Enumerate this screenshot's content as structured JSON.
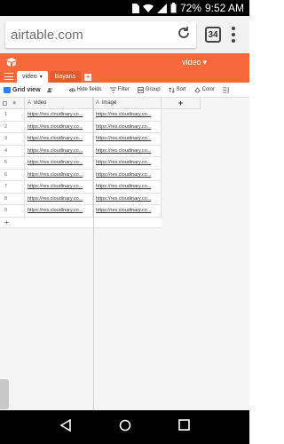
{
  "status_bar": {
    "battery": "72%",
    "time": "9:52 AM"
  },
  "browser": {
    "url": "airtable.com",
    "tab_count": "34"
  },
  "app": {
    "base_name": "video",
    "accent": "#f7693a"
  },
  "tabs": [
    {
      "label": "video",
      "active": true
    },
    {
      "label": "Bayans",
      "active": false
    }
  ],
  "toolbar": {
    "view_name": "Grid view",
    "hide_fields": "Hide fields",
    "filter": "Filter",
    "group": "Group",
    "sort": "Sort",
    "color": "Color"
  },
  "grid": {
    "columns": [
      {
        "name": "video"
      },
      {
        "name": "image"
      }
    ],
    "add_column": "+",
    "rows": [
      {
        "num": "1",
        "video": "https://res.cloudinary.co...",
        "image": "https://res.cloudinary.co..."
      },
      {
        "num": "2",
        "video": "https://res.cloudinary.co...",
        "image": "https://res.cloudinary.co..."
      },
      {
        "num": "3",
        "video": "https://res.cloudinary.co...",
        "image": "https://res.cloudinary.co..."
      },
      {
        "num": "4",
        "video": "https://res.cloudinary.co...",
        "image": "https://res.cloudinary.co..."
      },
      {
        "num": "5",
        "video": "https://res.cloudinary.co...",
        "image": "https://res.cloudinary.co..."
      },
      {
        "num": "6",
        "video": "https://res.cloudinary.co...",
        "image": "https://res.cloudinary.co..."
      },
      {
        "num": "7",
        "video": "https://res.cloudinary.co...",
        "image": "https://res.cloudinary.co..."
      },
      {
        "num": "8",
        "video": "https://res.cloudinary.co...",
        "image": "https://res.cloudinary.co..."
      },
      {
        "num": "9",
        "video": "https://res.cloudinary.co...",
        "image": "https://res.cloudinary.co..."
      }
    ],
    "add_row": "+"
  }
}
